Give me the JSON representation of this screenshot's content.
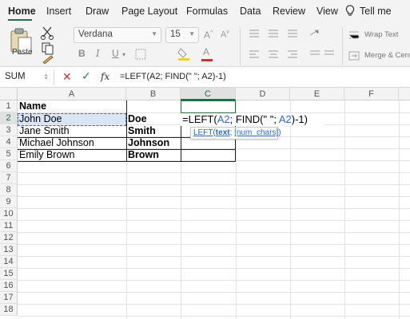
{
  "ribbon": {
    "tabs": [
      "Home",
      "Insert",
      "Draw",
      "Page Layout",
      "Formulas",
      "Data",
      "Review",
      "View",
      "Tell me"
    ],
    "active_tab": "Home"
  },
  "toolbar": {
    "paste_label": "Paste",
    "font_name": "Verdana",
    "font_size": "15",
    "bold_label": "B",
    "italic_label": "I",
    "underline_label": "U",
    "wrap_text_label": "Wrap Text",
    "merge_label": "Merge & Cent",
    "accent_color": "#1e7145"
  },
  "formula_bar": {
    "name_box": "SUM",
    "fx_label": "fx",
    "formula": "=LEFT(A2; FIND(\" \"; A2)-1)"
  },
  "grid": {
    "columns": [
      "A",
      "B",
      "C",
      "D",
      "E",
      "F"
    ],
    "rows": [
      "1",
      "2",
      "3",
      "4",
      "5",
      "6",
      "7",
      "8",
      "9",
      "10",
      "11",
      "12",
      "13",
      "14",
      "15",
      "16",
      "17",
      "18"
    ],
    "cells": {
      "A1": "Name",
      "A2": "John Doe",
      "A3": "Jane Smith",
      "A4": "Michael Johnson",
      "A5": "Emily Brown",
      "B2": "Doe",
      "B3": "Smith",
      "B4": "Johnson",
      "B5": "Brown"
    },
    "editing_cell": {
      "prefix": "=LEFT(",
      "ref1": "A2",
      "middle": "; FIND(\" \"; ",
      "ref2": "A2",
      "suffix": ")-1)"
    },
    "tooltip": {
      "func": "LEFT",
      "arg1": "text",
      "arg2": "[num_chars]"
    }
  }
}
